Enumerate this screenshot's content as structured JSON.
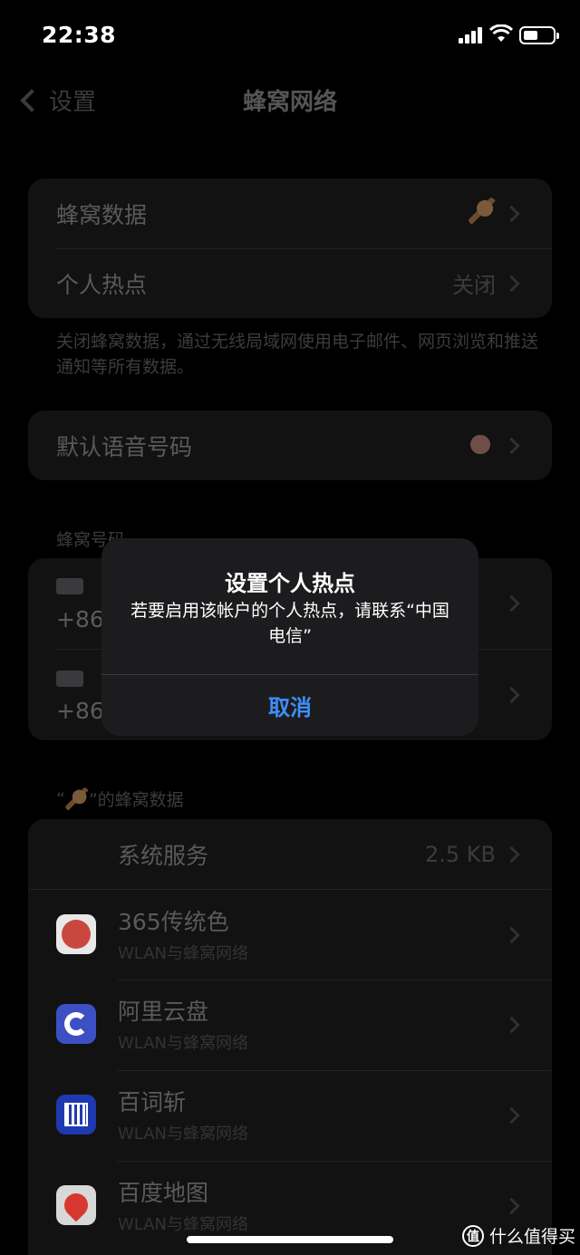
{
  "status_bar": {
    "time": "22:38"
  },
  "nav": {
    "back_label": "设置",
    "title": "蜂窝网络"
  },
  "group1": {
    "rows": [
      {
        "label": "蜂窝数据",
        "value": ""
      },
      {
        "label": "个人热点",
        "value": "关闭"
      }
    ]
  },
  "footnote1": "关闭蜂窝数据，通过无线局域网使用电子邮件、网页浏览和推送通知等所有数据。",
  "group2": {
    "label": "默认语音号码"
  },
  "section_sim": "蜂窝号码",
  "sim_rows": [
    {
      "number": "+86"
    },
    {
      "number": "+86"
    }
  ],
  "section_data_prefix": "“",
  "section_data_suffix": "”的蜂窝数据",
  "system_services": {
    "label": "系统服务",
    "value": "2.5 KB"
  },
  "apps": [
    {
      "name": "365传统色",
      "sub": "WLAN与蜂窝网络",
      "icon": "red-circle-app-icon",
      "color": "#d9544d"
    },
    {
      "name": "阿里云盘",
      "sub": "WLAN与蜂窝网络",
      "icon": "cloud-drive-app-icon",
      "color": "#4a5cf0"
    },
    {
      "name": "百词斩",
      "sub": "WLAN与蜂窝网络",
      "icon": "vocab-app-icon",
      "color": "#2a45c8"
    },
    {
      "name": "百度地图",
      "sub": "WLAN与蜂窝网络",
      "icon": "map-app-icon",
      "color": "#e0e0e0"
    }
  ],
  "alert": {
    "title": "设置个人热点",
    "message": "若要启用该帐户的个人热点，请联系“中国电信”",
    "button": "取消"
  },
  "watermark": {
    "icon": "值",
    "text": "什么值得买"
  }
}
